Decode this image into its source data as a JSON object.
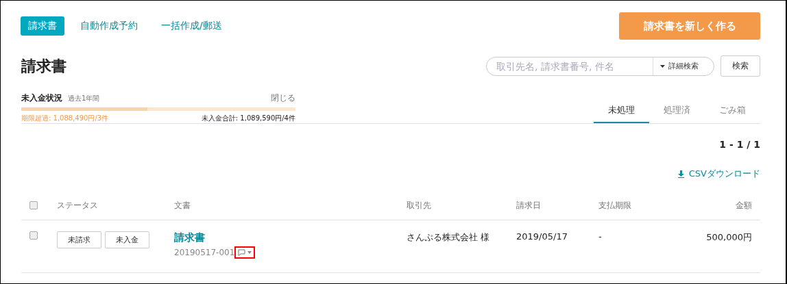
{
  "nav_tabs": [
    {
      "label": "請求書",
      "selected": true
    },
    {
      "label": "自動作成予約",
      "selected": false
    },
    {
      "label": "一括作成/郵送",
      "selected": false
    }
  ],
  "create_button": "請求書を新しく作る",
  "page_title": "請求書",
  "search": {
    "placeholder": "取引先名, 請求書番号, 件名",
    "advanced": "詳細検索",
    "button": "検索"
  },
  "unpaid_status": {
    "title": "未入金状況",
    "period": "過去1年間",
    "close": "閉じる",
    "level": 0.46,
    "overdue": "期限超過: 1,088,490円/3件",
    "total": "未入金合計: 1,089,590円/4件"
  },
  "list_tabs": [
    {
      "label": "未処理",
      "selected": true
    },
    {
      "label": "処理済",
      "selected": false
    },
    {
      "label": "ごみ箱",
      "selected": false
    }
  ],
  "pagination": "1 - 1 / 1",
  "csv_download": "CSVダウンロード",
  "table": {
    "select_all_checked": false,
    "columns": [
      "ステータス",
      "文書",
      "取引先",
      "請求日",
      "支払期限",
      "金額"
    ],
    "rows": [
      {
        "checked": false,
        "statuses": [
          "未請求",
          "未入金"
        ],
        "document": "請求書",
        "number": "20190517-001",
        "comment_highlighted": true,
        "client": "さんぷる株式会社 様",
        "date": "2019/05/17",
        "due": "-",
        "amount": "500,000円"
      }
    ]
  }
}
